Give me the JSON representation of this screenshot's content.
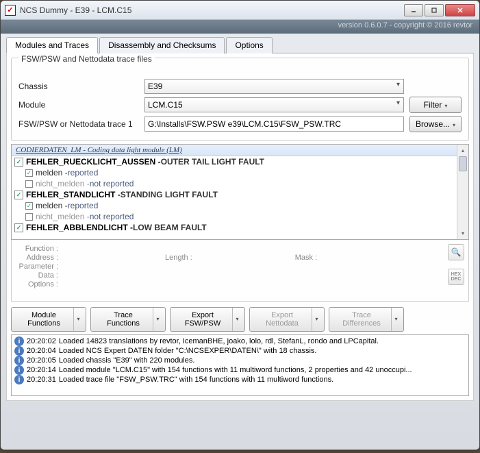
{
  "window": {
    "title": "NCS Dummy - E39 - LCM.C15",
    "version_line": "version 0.6.0.7 - copyright © 2016 revtor"
  },
  "tabs": {
    "t1": "Modules and Traces",
    "t2": "Disassembly and Checksums",
    "t3": "Options"
  },
  "fieldset": {
    "legend": "FSW/PSW and Nettodata trace files",
    "chassis_label": "Chassis",
    "chassis_value": "E39",
    "module_label": "Module",
    "module_value": "LCM.C15",
    "trace_label": "FSW/PSW or Nettodata trace 1",
    "trace_value": "G:\\Installs\\FSW.PSW e39\\LCM.C15\\FSW_PSW.TRC",
    "filter_btn": "Filter",
    "browse_btn": "Browse..."
  },
  "coding": {
    "header": "CODIERDATEN_LM  -  Coding data light module (LM)",
    "items": [
      {
        "name": "FEHLER_RUECKLICHT_AUSSEN",
        "desc": "OUTER TAIL LIGHT FAULT"
      },
      {
        "sub": true,
        "checked": true,
        "name": "melden",
        "desc": "reported"
      },
      {
        "sub": true,
        "checked": false,
        "dis": true,
        "name": "nicht_melden",
        "desc": "not reported"
      },
      {
        "name": "FEHLER_STANDLICHT",
        "desc": "STANDING LIGHT FAULT"
      },
      {
        "sub": true,
        "checked": true,
        "name": "melden",
        "desc": "reported"
      },
      {
        "sub": true,
        "checked": false,
        "dis": true,
        "name": "nicht_melden",
        "desc": "not reported"
      },
      {
        "name": "FEHLER_ABBLENDLICHT",
        "desc": "LOW BEAM FAULT"
      }
    ]
  },
  "details": {
    "function": "Function :",
    "address": "Address :",
    "length": "Length :",
    "mask": "Mask :",
    "parameter": "Parameter :",
    "data": "Data :",
    "options": "Options :",
    "hexdec": "HEX\nDEC"
  },
  "buttons": {
    "b1": "Module\nFunctions",
    "b2": "Trace\nFunctions",
    "b3": "Export\nFSW/PSW",
    "b4": "Export\nNettodata",
    "b5": "Trace\nDifferences"
  },
  "log": [
    {
      "ts": "20:20:02",
      "msg": "Loaded 14823 translations by revtor, IcemanBHE, joako, lolo, rdl, StefanL, rondo and LPCapital."
    },
    {
      "ts": "20:20:04",
      "msg": "Loaded NCS Expert DATEN folder \"C:\\NCSEXPER\\DATEN\\\" with 18 chassis."
    },
    {
      "ts": "20:20:05",
      "msg": "Loaded chassis \"E39\" with 220 modules."
    },
    {
      "ts": "20:20:14",
      "msg": "Loaded module \"LCM.C15\" with 154 functions with 11 multiword functions, 2 properties and 42 unoccupi..."
    },
    {
      "ts": "20:20:31",
      "msg": "Loaded trace file \"FSW_PSW.TRC\" with 154 functions with 11 multiword functions."
    }
  ]
}
